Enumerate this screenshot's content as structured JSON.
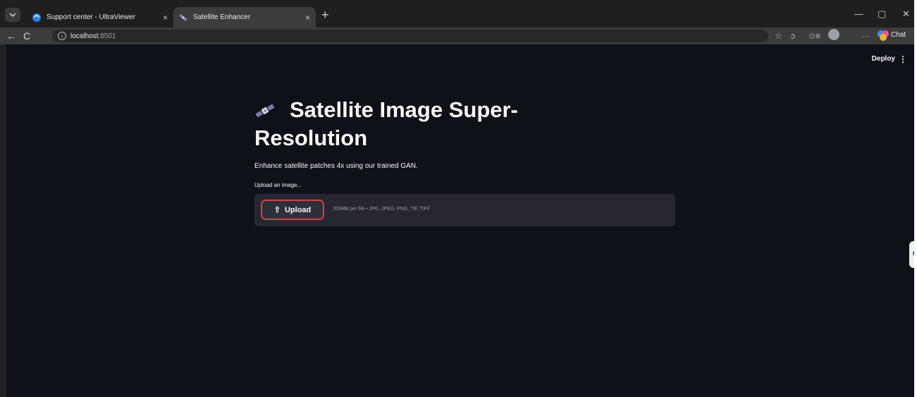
{
  "browser": {
    "tabs": [
      {
        "title": "Support center - UltraViewer",
        "active": false,
        "close": "×",
        "favicon": "ultraviewer-icon"
      },
      {
        "title": "Satellite Enhancer",
        "active": true,
        "close": "×",
        "favicon": "satellite-icon"
      }
    ],
    "new_tab": "+",
    "window_controls": {
      "minimize": "—",
      "maximize": "▢",
      "close": "✕"
    },
    "nav": {
      "back": "←",
      "reload": "C"
    },
    "address": {
      "host": "localhost",
      "port": ":8501"
    },
    "toolbar_icons": {
      "favorite": "☆",
      "extensions": "ↄ",
      "favorites_bar": "✩≡",
      "more": "···"
    },
    "chat_label": "Chat"
  },
  "app": {
    "header": {
      "deploy_label": "Deploy",
      "menu_icon": "⋮"
    },
    "title": "Satellite Image Super-Resolution",
    "subtitle": "Enhance satellite patches 4x using our trained GAN.",
    "uploader": {
      "label": "Upload an image...",
      "button_label": "Upload",
      "button_icon": "⇧",
      "limits": "200MB per file • JPG, JPEG, PNG, TIF, TIFF"
    }
  },
  "colors": {
    "app_background": "#0e1117",
    "dropzone": "#262730",
    "upload_border": "#d84040",
    "text": "#fafafa"
  }
}
